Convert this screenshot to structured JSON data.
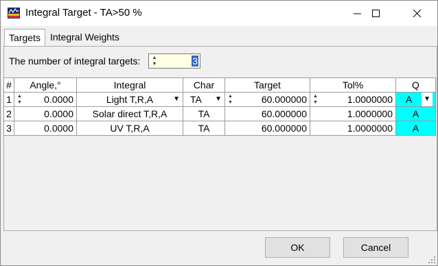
{
  "window": {
    "title": "Integral Target - TA>50 %"
  },
  "tabs": [
    {
      "label": "Targets"
    },
    {
      "label": "Integral Weights"
    }
  ],
  "count": {
    "label": "The number of integral targets:",
    "value": "3"
  },
  "table": {
    "headers": [
      "#",
      "Angle,°",
      "Integral",
      "Char",
      "Target",
      "Tol%",
      "Q"
    ],
    "rows": [
      {
        "num": "1",
        "angle": "0.0000",
        "integral": "Light T,R,A",
        "char": "TA",
        "target": "60.000000",
        "tol": "1.0000000",
        "q": "A"
      },
      {
        "num": "2",
        "angle": "0.0000",
        "integral": "Solar direct T,R,A",
        "char": "TA",
        "target": "60.000000",
        "tol": "1.0000000",
        "q": "A"
      },
      {
        "num": "3",
        "angle": "0.0000",
        "integral": "UV T,R,A",
        "char": "TA",
        "target": "60.000000",
        "tol": "1.0000000",
        "q": "A"
      }
    ]
  },
  "buttons": {
    "ok": "OK",
    "cancel": "Cancel"
  },
  "colors": {
    "q_highlight": "#00ffff",
    "selection": "#3366cc",
    "spin_bg": "#ffffe6"
  }
}
